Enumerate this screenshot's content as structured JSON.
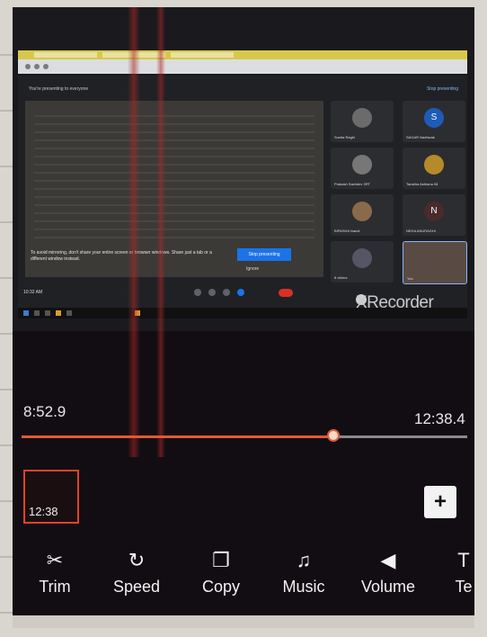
{
  "meeting": {
    "presenting_text": "You're presenting to everyone",
    "stop_presenting": "Stop presenting",
    "share_message": "To avoid mirroring, don't share your entire screen or browser windows. Share just a tab or a different window instead.",
    "stop_sharing_button": "Stop presenting",
    "ignore_label": "Ignore",
    "time": "10:32 AM",
    "participants": [
      {
        "name": "Sunita Raghi",
        "initial": ""
      },
      {
        "name": "SAGAR Nadhwak",
        "initial": "S"
      },
      {
        "name": "Prakash Sachdev 3RT",
        "initial": ""
      },
      {
        "name": "Tarakha Asthana 08",
        "initial": ""
      },
      {
        "name": "BIPASHA Nandi",
        "initial": ""
      },
      {
        "name": "NEHA ANURAGHI",
        "initial": "N"
      },
      {
        "name": "8 others",
        "initial": ""
      },
      {
        "name": "You",
        "initial": ""
      }
    ]
  },
  "watermark": "XRecorder",
  "playback": {
    "current_time": "8:52.9",
    "total_time": "12:38.4",
    "progress": 0.7
  },
  "clip": {
    "duration": "12:38"
  },
  "add_label": "+",
  "toolbar": [
    {
      "icon": "scissors-icon",
      "glyph": "✂",
      "label": "Trim"
    },
    {
      "icon": "speed-icon",
      "glyph": "↻",
      "label": "Speed"
    },
    {
      "icon": "copy-icon",
      "glyph": "❐",
      "label": "Copy"
    },
    {
      "icon": "music-icon",
      "glyph": "♫",
      "label": "Music"
    },
    {
      "icon": "volume-icon",
      "glyph": "◀",
      "label": "Volume"
    },
    {
      "icon": "text-icon",
      "glyph": "T",
      "label": "Te"
    }
  ],
  "colors": {
    "accent": "#e0593a",
    "clip_border": "#e0432a",
    "background": "#120d12"
  }
}
